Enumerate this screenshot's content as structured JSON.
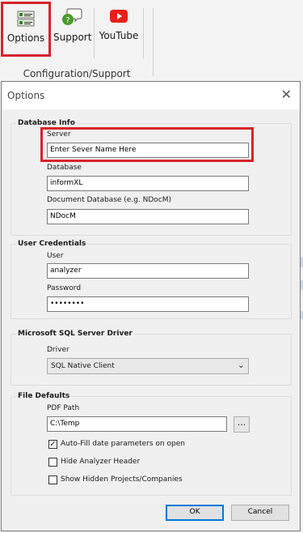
{
  "ribbon": {
    "options_label": "Options",
    "support_label": "Support",
    "youtube_label": "YouTube",
    "group_label": "Configuration/Support"
  },
  "dialog": {
    "title": "Options",
    "database_info": {
      "legend": "Database Info",
      "server_label": "Server",
      "server_value": "Enter Sever Name Here",
      "database_label": "Database",
      "database_value": "informXL",
      "doc_db_label": "Document Database (e.g. NDocM)",
      "doc_db_value": "NDocM"
    },
    "user_credentials": {
      "legend": "User Credentials",
      "user_label": "User",
      "user_value": "analyzer",
      "password_label": "Password",
      "password_value": "••••••••"
    },
    "sql_driver": {
      "legend": "Microsoft SQL Server Driver",
      "driver_label": "Driver",
      "driver_value": "SQL Native Client"
    },
    "file_defaults": {
      "legend": "File Defaults",
      "pdf_path_label": "PDF Path",
      "pdf_path_value": "C:\\Temp",
      "browse_label": "...",
      "autofill_label": "Auto-Fill date parameters on open",
      "autofill_checked": true,
      "hide_header_label": "Hide Analyzer Header",
      "hide_header_checked": false,
      "show_hidden_label": "Show Hidden Projects/Companies",
      "show_hidden_checked": false
    },
    "ok_label": "OK",
    "cancel_label": "Cancel"
  },
  "colors": {
    "highlight": "#d8232a",
    "focus_border": "#0078d7",
    "youtube_red": "#e62117",
    "options_green": "#3a7d2c"
  },
  "icons": [
    "options-list-icon",
    "support-chat-icon",
    "youtube-play-icon",
    "close-icon",
    "chevron-down-icon",
    "checkmark-icon"
  ]
}
